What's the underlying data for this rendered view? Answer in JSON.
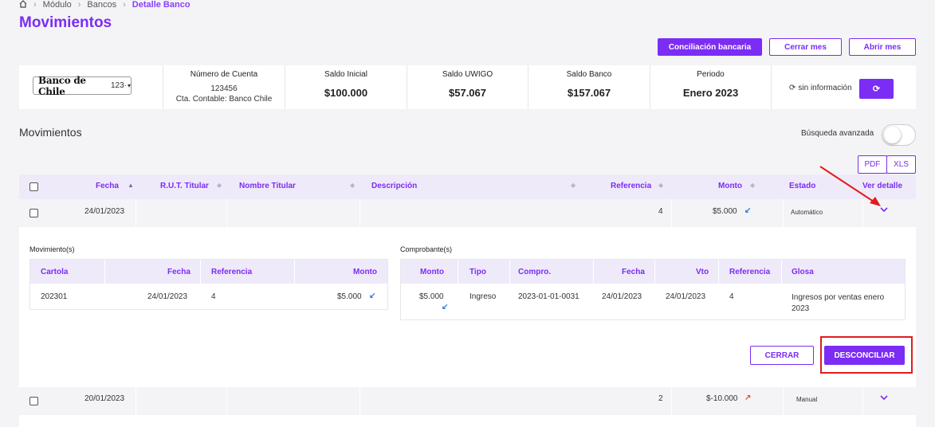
{
  "breadcrumb": {
    "items": [
      "Módulo",
      "Bancos"
    ],
    "active": "Detalle Banco"
  },
  "page_title": "Movimientos",
  "actions": {
    "conciliacion": "Conciliación bancaria",
    "cerrar_mes": "Cerrar mes",
    "abrir_mes": "Abrir mes"
  },
  "bank": {
    "logo_text": "Banco de Chile",
    "select_value": "123·",
    "cuenta_label": "Número de Cuenta",
    "cuenta_value": "123456",
    "cuenta_contable": "Cta. Contable: Banco Chile",
    "saldo_inicial_label": "Saldo Inicial",
    "saldo_inicial": "$100.000",
    "saldo_uwigo_label": "Saldo UWIGO",
    "saldo_uwigo": "$57.067",
    "saldo_banco_label": "Saldo Banco",
    "saldo_banco": "$157.067",
    "periodo_label": "Periodo",
    "periodo": "Enero 2023",
    "sync_status": "sin información"
  },
  "section": {
    "title": "Movimientos",
    "advanced_search": "Búsqueda avanzada"
  },
  "export": {
    "pdf": "PDF",
    "xls": "XLS"
  },
  "table": {
    "headers": {
      "fecha": "Fecha",
      "rut": "R.U.T. Titular",
      "nombre": "Nombre Titular",
      "descripcion": "Descripción",
      "referencia": "Referencia",
      "monto": "Monto",
      "estado": "Estado",
      "detalle": "Ver detalle"
    },
    "rows": [
      {
        "fecha": "24/01/2023",
        "referencia": "4",
        "monto": "$5.000",
        "estado": "Automático"
      },
      {
        "fecha": "20/01/2023",
        "referencia": "2",
        "monto": "$-10.000",
        "estado": "Manual"
      }
    ]
  },
  "detail": {
    "movimientos_title": "Movimiento(s)",
    "movimientos_headers": {
      "cartola": "Cartola",
      "fecha": "Fecha",
      "referencia": "Referencia",
      "monto": "Monto"
    },
    "movimientos_row": {
      "cartola": "202301",
      "fecha": "24/01/2023",
      "referencia": "4",
      "monto": "$5.000"
    },
    "comprobantes_title": "Comprobante(s)",
    "comprobantes_headers": {
      "monto": "Monto",
      "tipo": "Tipo",
      "compro": "Compro.",
      "fecha": "Fecha",
      "vto": "Vto",
      "referencia": "Referencia",
      "glosa": "Glosa"
    },
    "comprobantes_row": {
      "monto": "$5.000",
      "tipo": "Ingreso",
      "compro": "2023-01-01-0031",
      "fecha": "24/01/2023",
      "vto": "24/01/2023",
      "referencia": "4",
      "glosa": "Ingresos por ventas enero 2023"
    },
    "cerrar": "CERRAR",
    "desconciliar": "DESCONCILIAR"
  },
  "colors": {
    "accent": "#7b2cf5",
    "highlight": "#e01c1c",
    "up_arrow": "#e0533c",
    "down_arrow": "#2b7de0"
  }
}
